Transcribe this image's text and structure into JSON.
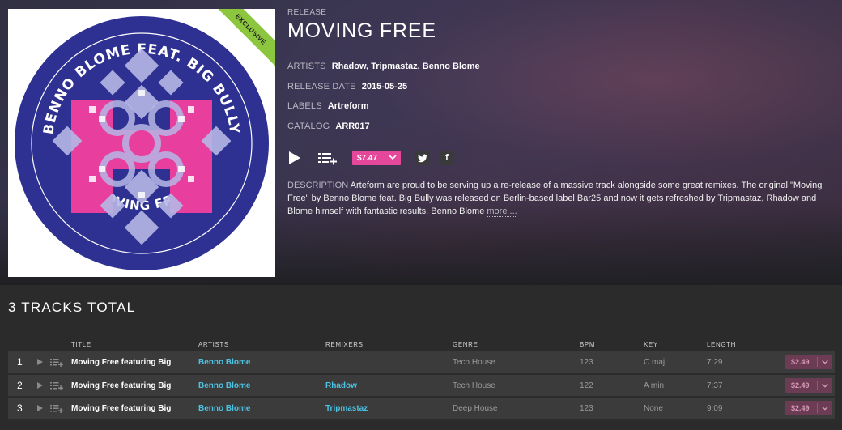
{
  "release": {
    "eyebrow": "RELEASE",
    "title": "MOVING FREE",
    "badge": "EXCLUSIVE",
    "artwork": {
      "top_text": "BENNO BLOME FEAT. BIG BULLY",
      "bottom_text": "MOVING FREE"
    },
    "artists_label": "ARTISTS",
    "artists": "Rhadow, Tripmastaz, Benno Blome",
    "release_date_label": "RELEASE DATE",
    "release_date": "2015-05-25",
    "labels_label": "LABELS",
    "label": "Artreform",
    "catalog_label": "CATALOG",
    "catalog": "ARR017",
    "price": "$7.47",
    "description_label": "DESCRIPTION",
    "description": "Arteform are proud to be serving up a re-release of a massive track alongside some great remixes. The original \"Moving Free\" by Benno Blome feat. Big Bully was released on Berlin-based label Bar25 and now it gets refreshed by Tripmastaz, Rhadow and Blome himself with fantastic results. Benno Blome",
    "more_link": "more ...",
    "twitter_glyph": "t",
    "facebook_glyph": "f",
    "accent_color": "#e5479a",
    "link_color": "#4cc3e4",
    "badge_color": "#8cc63f"
  },
  "tracks_section": {
    "title": "3 TRACKS TOTAL",
    "columns": {
      "title": "TITLE",
      "artists": "ARTISTS",
      "remixers": "REMIXERS",
      "genre": "GENRE",
      "bpm": "BPM",
      "key": "KEY",
      "length": "LENGTH"
    },
    "rows": [
      {
        "num": "1",
        "title": "Moving Free featuring Big",
        "artist": "Benno Blome",
        "remixer": "",
        "genre": "Tech House",
        "bpm": "123",
        "key": "C maj",
        "length": "7:29",
        "price": "$2.49"
      },
      {
        "num": "2",
        "title": "Moving Free featuring Big",
        "artist": "Benno Blome",
        "remixer": "Rhadow",
        "genre": "Tech House",
        "bpm": "122",
        "key": "A min",
        "length": "7:37",
        "price": "$2.49"
      },
      {
        "num": "3",
        "title": "Moving Free featuring Big",
        "artist": "Benno Blome",
        "remixer": "Tripmastaz",
        "genre": "Deep House",
        "bpm": "123",
        "key": "None",
        "length": "9:09",
        "price": "$2.49"
      }
    ]
  }
}
